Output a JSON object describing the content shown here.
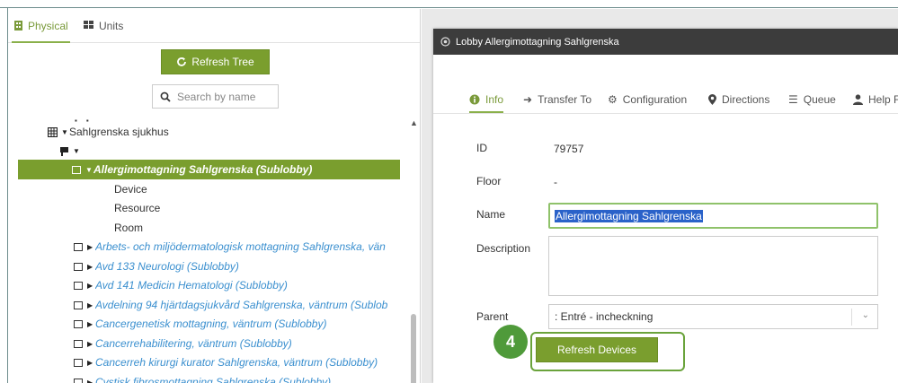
{
  "left_panel": {
    "tabs": [
      {
        "label": "Physical",
        "icon": "building-icon",
        "active": true
      },
      {
        "label": "Units",
        "icon": "grid-icon",
        "active": false
      }
    ],
    "refresh_tree_label": "Refresh Tree",
    "search_placeholder": "Search by name",
    "tree": {
      "root_label": "Sahlgrenska sjukhus",
      "selected_label": "Allergimottagning Sahlgrenska (Sublobby)",
      "children": [
        "Device",
        "Resource",
        "Room"
      ],
      "items": [
        "Arbets- och miljödermatologisk mottagning Sahlgrenska, vän",
        "Avd 133 Neurologi (Sublobby)",
        "Avd 141 Medicin Hematologi (Sublobby)",
        "Avdelning 94 hjärtdagsjukvård Sahlgrenska, väntrum (Sublob",
        "Cancergenetisk mottagning, väntrum (Sublobby)",
        "Cancerrehabilitering, väntrum (Sublobby)",
        "Cancerreh kirurgi kurator Sahlgrenska, väntrum (Sublobby)",
        "Cystisk fibrosmottagning Sahlgrenska (Sublobby)"
      ]
    }
  },
  "dialog": {
    "title": "Lobby Allergimottagning Sahlgrenska",
    "tabs": [
      {
        "label": "Info",
        "icon": "info-icon",
        "active": true
      },
      {
        "label": "Transfer To",
        "icon": "arrow-icon"
      },
      {
        "label": "Configuration",
        "icon": "cogs-icon"
      },
      {
        "label": "Directions",
        "icon": "map-marker-icon"
      },
      {
        "label": "Queue",
        "icon": "list-icon"
      },
      {
        "label": "Help F",
        "icon": "user-icon"
      }
    ],
    "fields": {
      "id_label": "ID",
      "id_value": "79757",
      "floor_label": "Floor",
      "floor_value": "-",
      "name_label": "Name",
      "name_value": "Allergimottagning Sahlgrenska",
      "description_label": "Description",
      "description_value": "",
      "parent_label": "Parent",
      "parent_value": ": Entré - incheckning"
    },
    "refresh_devices_label": "Refresh Devices",
    "step_badge": "4"
  },
  "colors": {
    "accent_green": "#7a9e2e",
    "header_dark": "#3c3c3c",
    "link_blue": "#3a8fcf",
    "selection_blue": "#2a62c9"
  }
}
